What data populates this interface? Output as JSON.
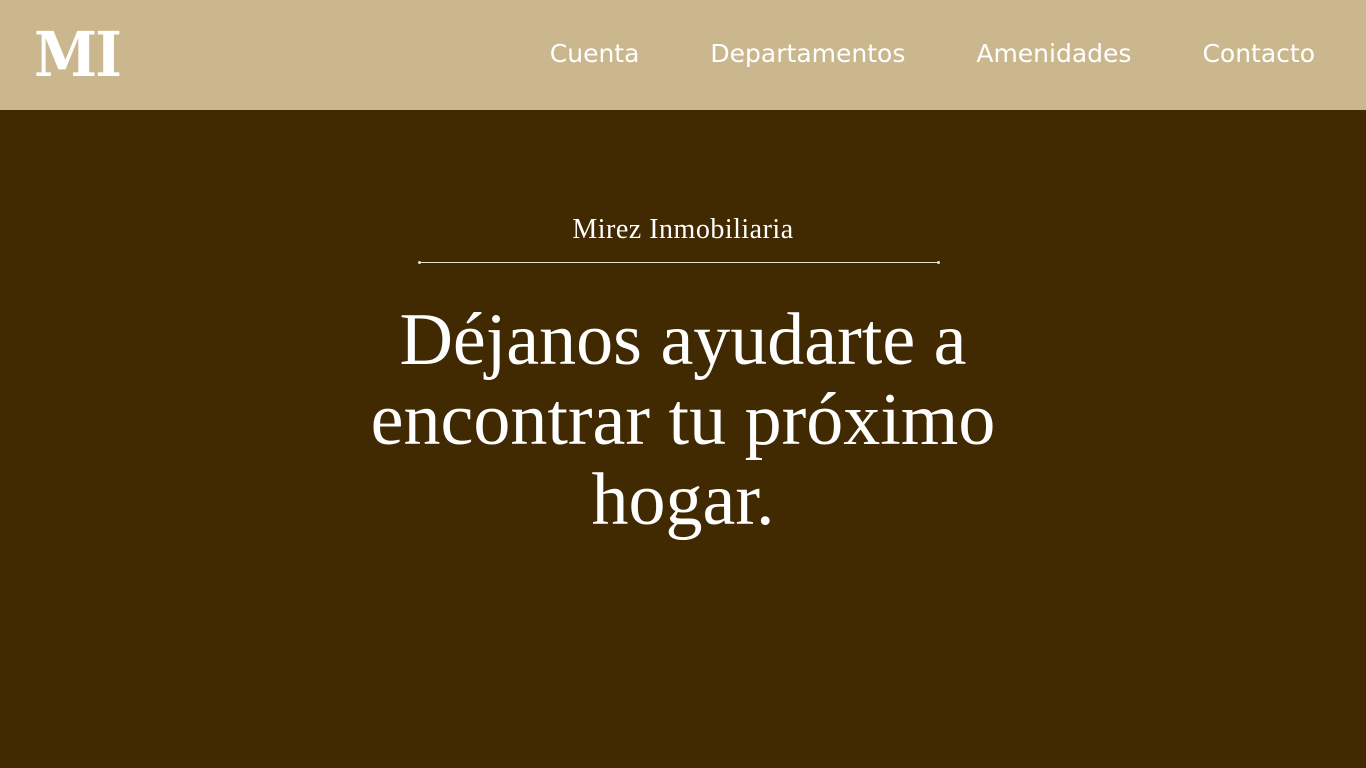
{
  "header": {
    "logo": "MI",
    "nav": [
      {
        "label": "Cuenta"
      },
      {
        "label": "Departamentos"
      },
      {
        "label": "Amenidades"
      },
      {
        "label": "Contacto"
      }
    ]
  },
  "hero": {
    "brand": "Mirez Inmobiliaria",
    "headline": "Déjanos ayudarte a encontrar tu próximo hogar."
  },
  "colors": {
    "header_bg": "#cab78e",
    "page_bg": "#412a02",
    "text": "#ffffff"
  }
}
